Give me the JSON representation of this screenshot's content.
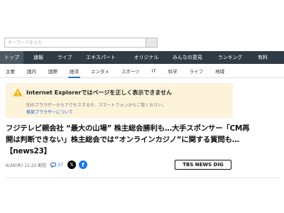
{
  "search": {
    "placeholder": "キーワードを入力",
    "value": ""
  },
  "nav_primary": {
    "items": [
      {
        "label": "トップ"
      },
      {
        "label": "速報"
      },
      {
        "label": "ライブ"
      },
      {
        "label": "エキスパート"
      },
      {
        "label": "オリジナル"
      },
      {
        "label": "みんなの意見"
      },
      {
        "label": "ランキング"
      },
      {
        "label": "有料"
      }
    ],
    "active_index": 0
  },
  "nav_secondary": {
    "items": [
      {
        "label": "主要"
      },
      {
        "label": "国内"
      },
      {
        "label": "国際"
      },
      {
        "label": "経済"
      },
      {
        "label": "エンタメ"
      },
      {
        "label": "スポーツ"
      },
      {
        "label": "IT"
      },
      {
        "label": "科学"
      },
      {
        "label": "ライフ"
      },
      {
        "label": "地域"
      }
    ],
    "active_index": 3
  },
  "warning": {
    "icon": "warning-icon",
    "title": "Internet Explorerではページを正しく表示できません",
    "subtitle": "別のブラウザーからアクセスするか、スマートフォンからご覧ください。",
    "link": "推奨ブラウザーについて",
    "accent": "#f0b400"
  },
  "article": {
    "headline": "フジテレビ親会社 “最大の山場” 株主総会勝利も…大手スポンサー「CM再開は判断できない」株主総会では“オンラインカジノ”に関する質問も…【news23】",
    "date": "6/26(木) 11:22 配信",
    "comment_count": "17",
    "source": "TBS NEWS DIG"
  },
  "colors": {
    "nav_bg": "#2f3b45",
    "nav_active": "#4b5963",
    "warning_bg": "#fdf3db",
    "link": "#2a66c7"
  }
}
